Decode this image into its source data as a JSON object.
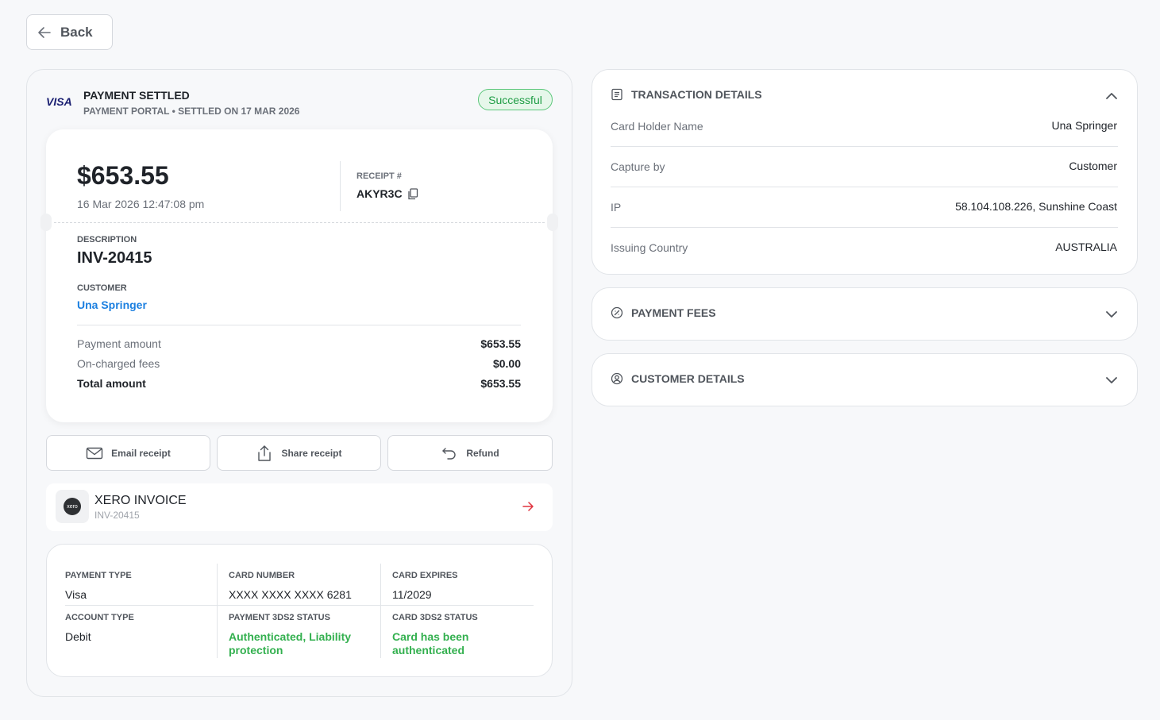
{
  "back_label": "Back",
  "payment": {
    "card_brand": "VISA",
    "title": "PAYMENT SETTLED",
    "subtitle": "PAYMENT PORTAL • SETTLED ON 17 MAR 2026",
    "status": "Successful",
    "amount": "$653.55",
    "datetime": "16 Mar 2026 12:47:08 pm",
    "receipt_label": "RECEIPT #",
    "receipt_no": "AKYR3C",
    "description_label": "DESCRIPTION",
    "description": "INV-20415",
    "customer_label": "CUSTOMER",
    "customer": "Una Springer",
    "rows": [
      {
        "label": "Payment amount",
        "value": "$653.55"
      },
      {
        "label": "On-charged fees",
        "value": "$0.00"
      },
      {
        "label": "Total amount",
        "value": "$653.55"
      }
    ]
  },
  "actions": {
    "email": "Email receipt",
    "share": "Share receipt",
    "refund": "Refund"
  },
  "xero": {
    "logo_text": "xero",
    "title": "XERO INVOICE",
    "invoice": "INV-20415"
  },
  "card_info": {
    "payment_type_label": "PAYMENT TYPE",
    "payment_type": "Visa",
    "card_number_label": "CARD NUMBER",
    "card_number": "XXXX XXXX XXXX 6281",
    "card_expires_label": "CARD EXPIRES",
    "card_expires": "11/2029",
    "account_type_label": "ACCOUNT TYPE",
    "account_type": "Debit",
    "payment_3ds2_label": "PAYMENT 3DS2 STATUS",
    "payment_3ds2_line1": "Authenticated, Liability",
    "payment_3ds2_line2": "protection",
    "card_3ds2_label": "CARD 3DS2 STATUS",
    "card_3ds2_line1": "Card has been",
    "card_3ds2_line2": "authenticated"
  },
  "transaction_details": {
    "title": "TRANSACTION DETAILS",
    "rows": [
      {
        "label": "Card Holder Name",
        "value": "Una Springer"
      },
      {
        "label": "Capture by",
        "value": "Customer"
      },
      {
        "label": "IP",
        "value": "58.104.108.226, Sunshine Coast"
      },
      {
        "label": "Issuing Country",
        "value": "AUSTRALIA"
      }
    ]
  },
  "payment_fees": {
    "title": "PAYMENT FEES"
  },
  "customer_details": {
    "title": "CUSTOMER DETAILS"
  },
  "colors": {
    "success_green": "#33b04f",
    "link_blue": "#1b7fe0",
    "xero_arrow_red": "#e0343f"
  }
}
